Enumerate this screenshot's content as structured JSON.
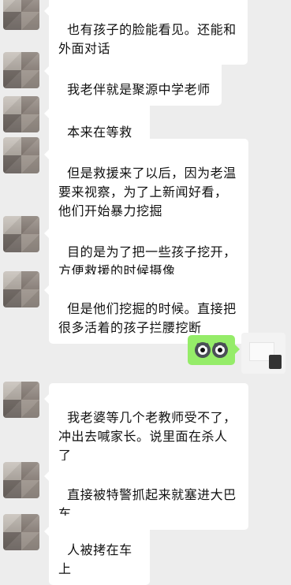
{
  "messages": [
    {
      "text": "也有孩子的脸能看见。还能和\n外面对话"
    },
    {
      "text": "我老伴就是聚源中学老师"
    },
    {
      "text": "本来在等救援"
    },
    {
      "text": "但是救援来了以后，因为老温\n要来视察，为了上新闻好看，\n他们开始暴力挖掘"
    },
    {
      "text": "目的是为了把一些孩子挖开，\n方便救援的时候摄像"
    },
    {
      "text": "但是他们挖掘的时候。直接把\n很多活着的孩子拦腰挖断"
    },
    {
      "text": "我老婆等几个老教师受不了，\n冲出去喊家长。说里面在杀人\n了"
    },
    {
      "text": "直接被特警抓起来就塞进大巴\n车"
    },
    {
      "text": "人被拷在车上"
    }
  ],
  "sent": {
    "icon": "owl-emoji-icon"
  },
  "colors": {
    "background": "#ededed",
    "received_bubble": "#ffffff",
    "sent_bubble": "#95ec69"
  }
}
